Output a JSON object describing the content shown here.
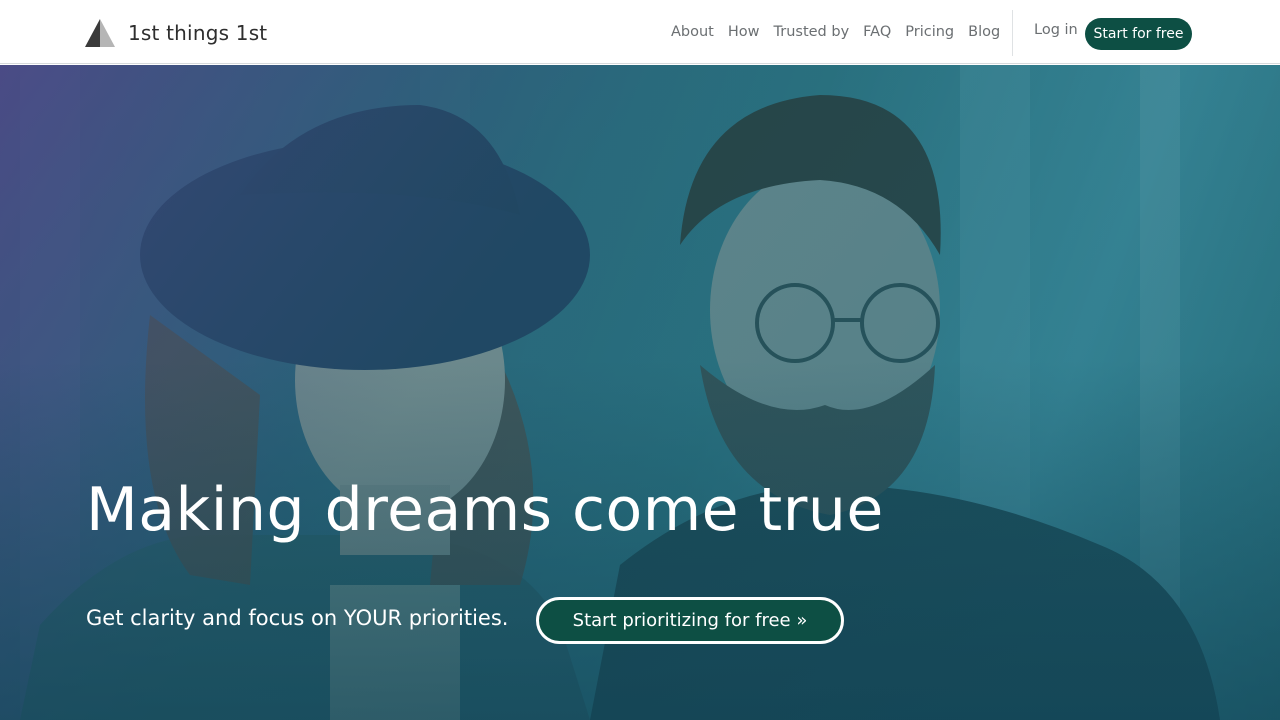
{
  "brand": {
    "name": "1st things 1st",
    "logo_icon": "triangle-logo-icon"
  },
  "nav": {
    "items": [
      {
        "label": "About"
      },
      {
        "label": "How"
      },
      {
        "label": "Trusted by"
      },
      {
        "label": "FAQ"
      },
      {
        "label": "Pricing"
      },
      {
        "label": "Blog"
      }
    ],
    "login_label": "Log in",
    "cta_label": "Start for free"
  },
  "hero": {
    "title": "Making dreams come true",
    "subtitle": "Get clarity and focus on YOUR priorities.",
    "cta_label": "Start prioritizing for free »",
    "image": "hero-photo-couple"
  },
  "colors": {
    "primary": "#0d4f44",
    "nav_text": "#6b6f72",
    "hero_overlay_start": "#4b4a84",
    "hero_overlay_end": "#2c6e7c"
  }
}
